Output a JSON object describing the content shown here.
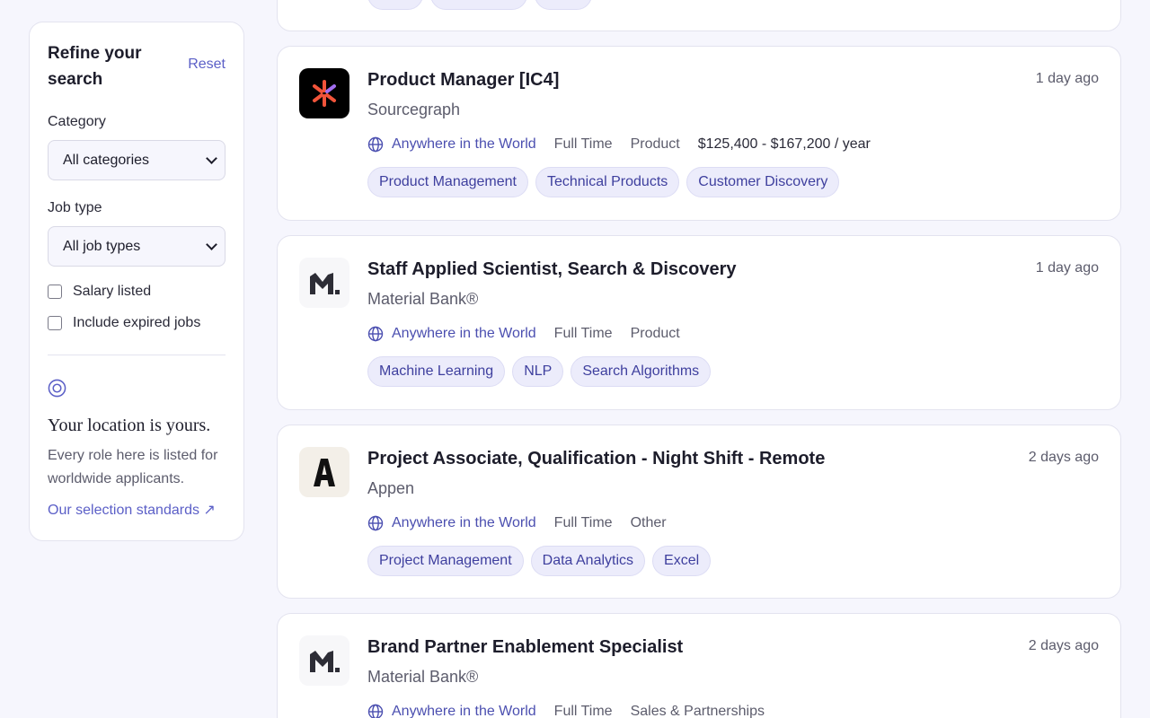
{
  "sidebar": {
    "title": "Refine your search",
    "reset_label": "Reset",
    "category_label": "Category",
    "category_value": "All categories",
    "jobtype_label": "Job type",
    "jobtype_value": "All job types",
    "salary_label": "Salary listed",
    "expired_label": "Include expired jobs",
    "location_title": "Your location is yours.",
    "location_text": "Every role here is listed for worldwide applicants.",
    "standards_link": "Our selection standards ↗"
  },
  "jobs": [
    {
      "title": "Product Manager [IC4]",
      "company": "Sourcegraph",
      "time": "1 day ago",
      "location": "Anywhere in the World",
      "type": "Full Time",
      "category": "Product",
      "salary": "$125,400 - $167,200 / year",
      "tags": [
        "Product Management",
        "Technical Products",
        "Customer Discovery"
      ]
    },
    {
      "title": "Staff Applied Scientist, Search & Discovery",
      "company": "Material Bank®",
      "time": "1 day ago",
      "location": "Anywhere in the World",
      "type": "Full Time",
      "category": "Product",
      "tags": [
        "Machine Learning",
        "NLP",
        "Search Algorithms"
      ]
    },
    {
      "title": "Project Associate, Qualification - Night Shift - Remote",
      "company": "Appen",
      "time": "2 days ago",
      "location": "Anywhere in the World",
      "type": "Full Time",
      "category": "Other",
      "tags": [
        "Project Management",
        "Data Analytics",
        "Excel"
      ]
    },
    {
      "title": "Brand Partner Enablement Specialist",
      "company": "Material Bank®",
      "time": "2 days ago",
      "location": "Anywhere in the World",
      "type": "Full Time",
      "category": "Sales & Partnerships"
    }
  ],
  "colors": {
    "accent": "#5b5fc7",
    "background": "#f6f6fd",
    "tag_bg": "#ececfb"
  }
}
